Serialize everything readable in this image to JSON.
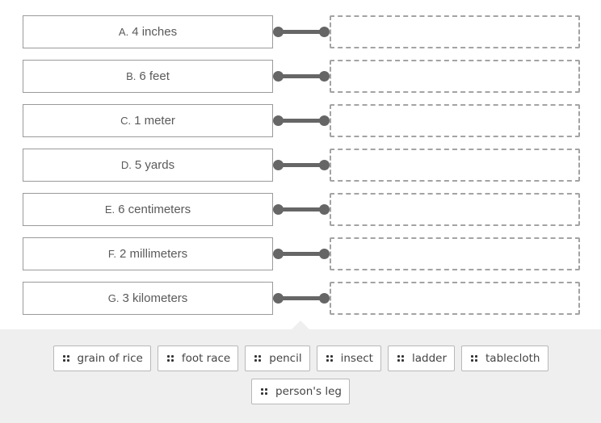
{
  "terms": [
    {
      "letter": "A.",
      "label": "4 inches"
    },
    {
      "letter": "B.",
      "label": "6 feet"
    },
    {
      "letter": "C.",
      "label": "1 meter"
    },
    {
      "letter": "D.",
      "label": "5 yards"
    },
    {
      "letter": "E.",
      "label": "6 centimeters"
    },
    {
      "letter": "F.",
      "label": "2 millimeters"
    },
    {
      "letter": "G.",
      "label": "3 kilometers"
    }
  ],
  "options": [
    {
      "label": "grain of rice",
      "icon": "drag-handle-icon"
    },
    {
      "label": "foot race",
      "icon": "drag-handle-icon"
    },
    {
      "label": "pencil",
      "icon": "drag-handle-icon"
    },
    {
      "label": "insect",
      "icon": "drag-handle-icon"
    },
    {
      "label": "ladder",
      "icon": "drag-handle-icon"
    },
    {
      "label": "tablecloth",
      "icon": "drag-handle-icon"
    },
    {
      "label": "person's leg",
      "icon": "drag-handle-icon"
    }
  ]
}
